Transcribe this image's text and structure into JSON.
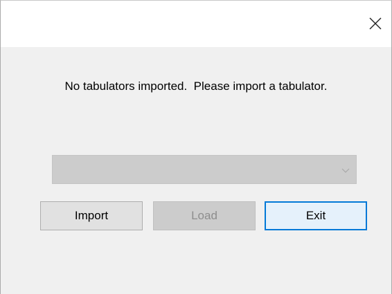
{
  "window": {
    "close_glyph": "close-icon"
  },
  "dialog": {
    "message": "No tabulators imported.  Please import a tabulator.",
    "tabulator_select": {
      "selected_value": "",
      "chevron": "chevron-down-icon"
    },
    "buttons": {
      "import_label": "Import",
      "load_label": "Load",
      "exit_label": "Exit"
    }
  },
  "colors": {
    "focus_border": "#0078d7",
    "disabled_fill": "#cccccc",
    "disabled_text": "#8d8d8d"
  }
}
